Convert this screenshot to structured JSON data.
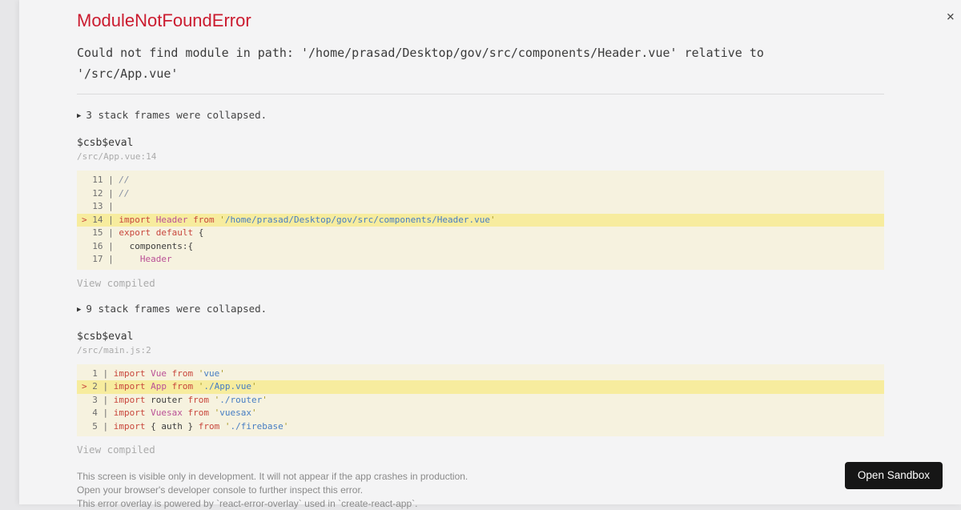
{
  "icons": {
    "close": "×",
    "collapse_arrow": "▶"
  },
  "colors": {
    "title_red": "#cb1b2f",
    "code_block_bg": "#f6f2df",
    "highlight_line_bg": "#f7ec9e",
    "button_bg": "#161616"
  },
  "header": {
    "title": "ModuleNotFoundError"
  },
  "message": "Could not find module in path: '/home/prasad/Desktop/gov/src/components/Header.vue' relative to '/src/App.vue'",
  "frames": [
    {
      "collapsed_note": "3 stack frames were collapsed.",
      "function": "$csb$eval",
      "location": "/src/App.vue:14",
      "view_compiled": "View compiled",
      "code": [
        {
          "num": "11",
          "mark": false,
          "tokens": [
            {
              "c": "cm",
              "t": "//"
            }
          ]
        },
        {
          "num": "12",
          "mark": false,
          "tokens": [
            {
              "c": "cm",
              "t": "//"
            }
          ]
        },
        {
          "num": "13",
          "mark": false,
          "tokens": []
        },
        {
          "num": "14",
          "mark": true,
          "tokens": [
            {
              "c": "k",
              "t": "import"
            },
            {
              "c": "p",
              "t": " "
            },
            {
              "c": "v",
              "t": "Header"
            },
            {
              "c": "p",
              "t": " "
            },
            {
              "c": "k",
              "t": "from"
            },
            {
              "c": "p",
              "t": " "
            },
            {
              "c": "q",
              "t": "'"
            },
            {
              "c": "s",
              "t": "/home/prasad/Desktop/gov/src/components/Header.vue"
            },
            {
              "c": "q",
              "t": "'"
            }
          ]
        },
        {
          "num": "15",
          "mark": false,
          "tokens": [
            {
              "c": "k",
              "t": "export"
            },
            {
              "c": "p",
              "t": " "
            },
            {
              "c": "k",
              "t": "default"
            },
            {
              "c": "p",
              "t": " {"
            }
          ]
        },
        {
          "num": "16",
          "mark": false,
          "tokens": [
            {
              "c": "p",
              "t": "  components:{"
            }
          ]
        },
        {
          "num": "17",
          "mark": false,
          "tokens": [
            {
              "c": "p",
              "t": "    "
            },
            {
              "c": "v",
              "t": "Header"
            }
          ]
        }
      ]
    },
    {
      "collapsed_note": "9 stack frames were collapsed.",
      "function": "$csb$eval",
      "location": "/src/main.js:2",
      "view_compiled": "View compiled",
      "code": [
        {
          "num": "1",
          "mark": false,
          "tokens": [
            {
              "c": "k",
              "t": "import"
            },
            {
              "c": "p",
              "t": " "
            },
            {
              "c": "v",
              "t": "Vue"
            },
            {
              "c": "p",
              "t": " "
            },
            {
              "c": "k",
              "t": "from"
            },
            {
              "c": "p",
              "t": " "
            },
            {
              "c": "q",
              "t": "'"
            },
            {
              "c": "s",
              "t": "vue"
            },
            {
              "c": "q",
              "t": "'"
            }
          ]
        },
        {
          "num": "2",
          "mark": true,
          "tokens": [
            {
              "c": "k",
              "t": "import"
            },
            {
              "c": "p",
              "t": " "
            },
            {
              "c": "v",
              "t": "App"
            },
            {
              "c": "p",
              "t": " "
            },
            {
              "c": "k",
              "t": "from"
            },
            {
              "c": "p",
              "t": " "
            },
            {
              "c": "q",
              "t": "'"
            },
            {
              "c": "s",
              "t": "./App.vue"
            },
            {
              "c": "q",
              "t": "'"
            }
          ]
        },
        {
          "num": "3",
          "mark": false,
          "tokens": [
            {
              "c": "k",
              "t": "import"
            },
            {
              "c": "p",
              "t": " router "
            },
            {
              "c": "k",
              "t": "from"
            },
            {
              "c": "p",
              "t": " "
            },
            {
              "c": "q",
              "t": "'"
            },
            {
              "c": "s",
              "t": "./router"
            },
            {
              "c": "q",
              "t": "'"
            }
          ]
        },
        {
          "num": "4",
          "mark": false,
          "tokens": [
            {
              "c": "k",
              "t": "import"
            },
            {
              "c": "p",
              "t": " "
            },
            {
              "c": "v",
              "t": "Vuesax"
            },
            {
              "c": "p",
              "t": " "
            },
            {
              "c": "k",
              "t": "from"
            },
            {
              "c": "p",
              "t": " "
            },
            {
              "c": "q",
              "t": "'"
            },
            {
              "c": "s",
              "t": "vuesax"
            },
            {
              "c": "q",
              "t": "'"
            }
          ]
        },
        {
          "num": "5",
          "mark": false,
          "tokens": [
            {
              "c": "k",
              "t": "import"
            },
            {
              "c": "p",
              "t": " { auth } "
            },
            {
              "c": "k",
              "t": "from"
            },
            {
              "c": "p",
              "t": " "
            },
            {
              "c": "q",
              "t": "'"
            },
            {
              "c": "s",
              "t": "./firebase"
            },
            {
              "c": "q",
              "t": "'"
            }
          ]
        }
      ]
    }
  ],
  "footer": {
    "lines": [
      "This screen is visible only in development. It will not appear if the app crashes in production.",
      "Open your browser's developer console to further inspect this error.",
      "This error overlay is powered by `react-error-overlay` used in `create-react-app`."
    ]
  },
  "sandbox_button": {
    "label": "Open Sandbox"
  }
}
